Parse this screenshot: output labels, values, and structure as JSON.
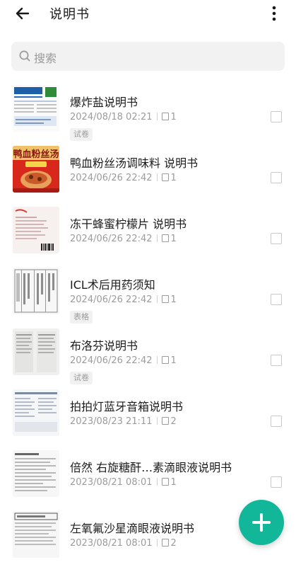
{
  "header": {
    "title": "说明书",
    "back_icon": "arrow-left-icon",
    "more_icon": "more-vertical-icon"
  },
  "search": {
    "placeholder": "搜索",
    "icon": "search-icon"
  },
  "accent_color": "#12b79a",
  "items": [
    {
      "name": "爆炸盐说明书",
      "datetime": "2024/08/18 02:21",
      "pages": "1",
      "tag": "试卷"
    },
    {
      "name": "鸭血粉丝汤调味料 说明书",
      "datetime": "2024/06/26 22:42",
      "pages": "1",
      "tag": ""
    },
    {
      "name": "冻干蜂蜜柠檬片 说明书",
      "datetime": "2024/06/26 22:42",
      "pages": "1",
      "tag": ""
    },
    {
      "name": "ICL术后用药须知",
      "datetime": "2024/06/26 22:42",
      "pages": "1",
      "tag": "表格"
    },
    {
      "name": "布洛芬说明书",
      "datetime": "2024/06/26 22:42",
      "pages": "1",
      "tag": "试卷"
    },
    {
      "name": "拍拍灯蓝牙音箱说明书",
      "datetime": "2023/08/23 21:11",
      "pages": "2",
      "tag": ""
    },
    {
      "name": "倍然 右旋糖酐…素滴眼液说明书",
      "datetime": "2023/08/21 08:01",
      "pages": "1",
      "tag": ""
    },
    {
      "name": "左氧氟沙星滴眼液说明书",
      "datetime": "2023/08/21 08:01",
      "pages": "2",
      "tag": ""
    }
  ],
  "thumb_texts": {
    "item_1": "鸭血粉丝汤"
  },
  "fab": {
    "icon": "plus-icon"
  }
}
